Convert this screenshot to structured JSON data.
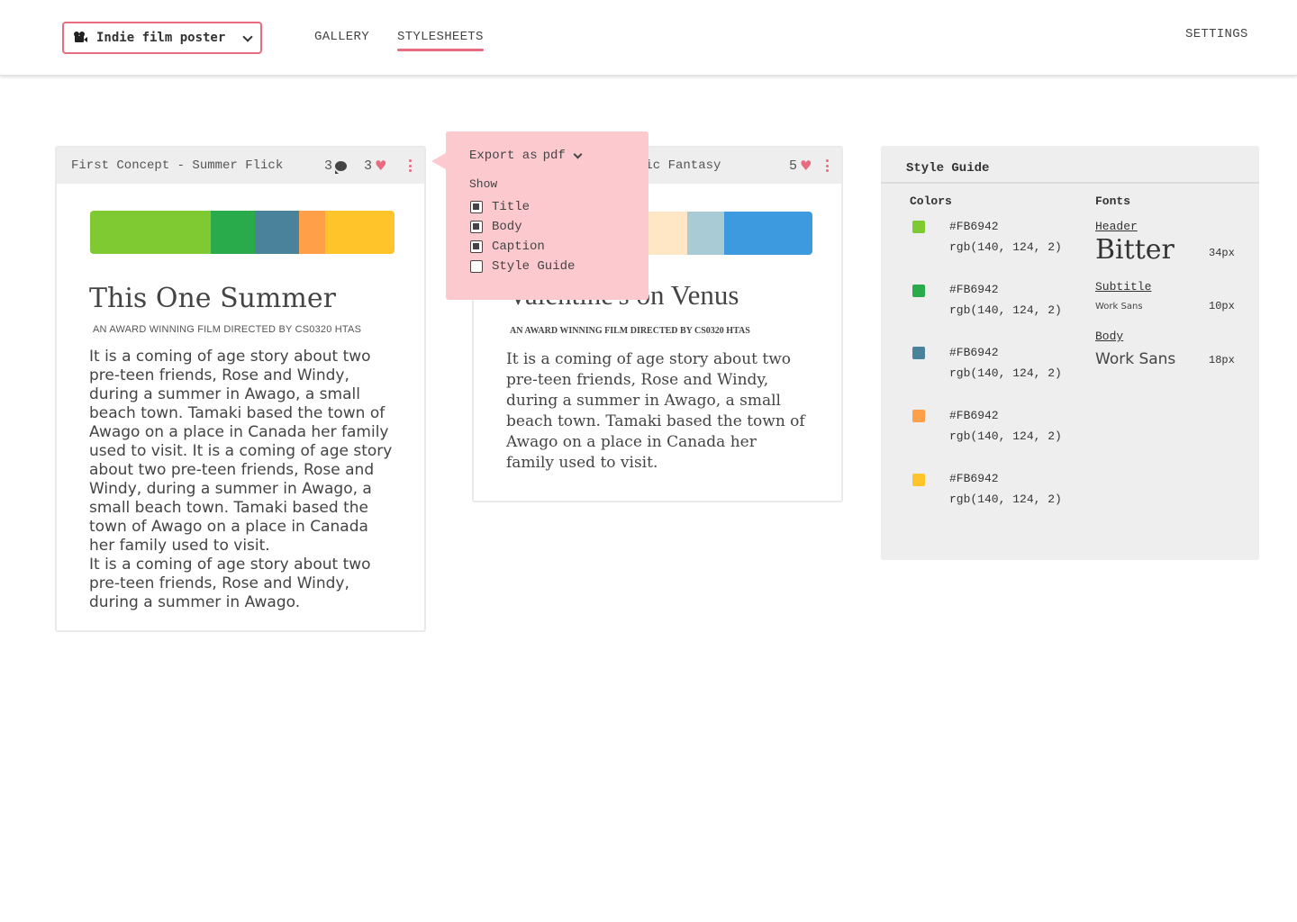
{
  "header": {
    "project_name": "Indie film poster",
    "nav": {
      "gallery": "GALLERY",
      "stylesheets": "STYLESHEETS",
      "settings": "SETTINGS"
    },
    "accent_color": "#e86b7f"
  },
  "cards": [
    {
      "title": "First Concept - Summer Flick",
      "comments": "3",
      "likes": "3",
      "palette": [
        "#7fca33",
        "#29ab4b",
        "#4a829c",
        "#ffa048",
        "#ffc429"
      ],
      "poster_title": "This One Summer",
      "poster_subtitle": "AN AWARD WINNING FILM DIRECTED BY CS0320 HTAS",
      "poster_body": "It is a coming of age story about two pre-teen friends, Rose and Windy, during a summer in Awago, a small beach town. Tamaki based the town of Awago on a place in Canada her family used to visit. It is a coming of age story about two pre-teen friends, Rose and Windy, during a summer in Awago, a small beach town. Tamaki based the town of Awago on a place in Canada her family used to visit.\nIt is a coming of age story about two pre-teen friends, Rose and Windy, during a summer in Awago."
    },
    {
      "title_visible": "tic Fantasy",
      "likes": "5",
      "palette": [
        "#ffe6c4",
        "#a8cbd6",
        "#3e9ade"
      ],
      "poster_title": "Valentine's on Venus",
      "poster_subtitle": "AN AWARD WINNING FILM DIRECTED BY CS0320 HTAS",
      "poster_body": "It is a coming of age story about two pre-teen friends, Rose and Windy, during a summer in Awago, a small beach town. Tamaki based the town of Awago on a place in Canada her family used to visit."
    }
  ],
  "export_popover": {
    "label": "Export as",
    "format": "pdf",
    "show_label": "Show",
    "options": [
      {
        "label": "Title",
        "checked": true
      },
      {
        "label": "Body",
        "checked": true
      },
      {
        "label": "Caption",
        "checked": true
      },
      {
        "label": "Style Guide",
        "checked": false
      }
    ]
  },
  "style_guide": {
    "title": "Style Guide",
    "colors_heading": "Colors",
    "fonts_heading": "Fonts",
    "colors": [
      {
        "swatch": "#7fca33",
        "hex": "#FB6942",
        "rgb": "rgb(140, 124, 2)"
      },
      {
        "swatch": "#29ab4b",
        "hex": "#FB6942",
        "rgb": "rgb(140, 124, 2)"
      },
      {
        "swatch": "#4a829c",
        "hex": "#FB6942",
        "rgb": "rgb(140, 124, 2)"
      },
      {
        "swatch": "#ffa048",
        "hex": "#FB6942",
        "rgb": "rgb(140, 124, 2)"
      },
      {
        "swatch": "#ffc429",
        "hex": "#FB6942",
        "rgb": "rgb(140, 124, 2)"
      }
    ],
    "fonts": [
      {
        "role": "Header",
        "sample": "Bitter",
        "size": "34px"
      },
      {
        "role": "Subtitle",
        "sample": "Work Sans",
        "size": "10px"
      },
      {
        "role": "Body",
        "sample": "Work Sans",
        "size": "18px"
      }
    ]
  }
}
